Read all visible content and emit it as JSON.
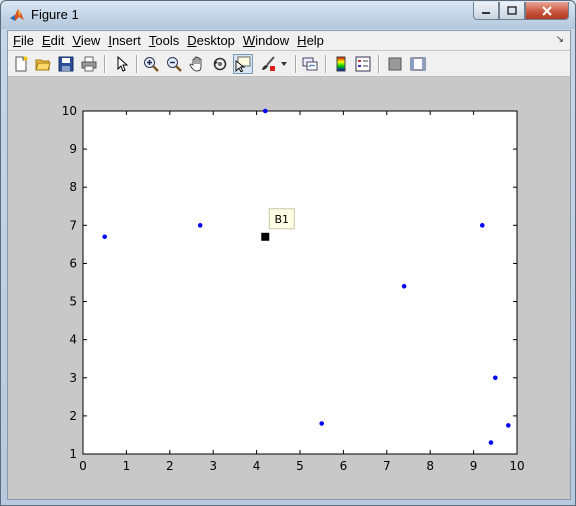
{
  "window": {
    "title": "Figure 1"
  },
  "menu": [
    {
      "label": "File",
      "key": "F",
      "rest": "ile"
    },
    {
      "label": "Edit",
      "key": "E",
      "rest": "dit"
    },
    {
      "label": "View",
      "key": "V",
      "rest": "iew"
    },
    {
      "label": "Insert",
      "key": "I",
      "rest": "nsert"
    },
    {
      "label": "Tools",
      "key": "T",
      "rest": "ools"
    },
    {
      "label": "Desktop",
      "key": "D",
      "rest": "esktop"
    },
    {
      "label": "Window",
      "key": "W",
      "rest": "indow"
    },
    {
      "label": "Help",
      "key": "H",
      "rest": "elp"
    }
  ],
  "toolbar": [
    "new-figure-icon",
    "open-file-icon",
    "save-icon",
    "print-icon",
    "edit-plot-icon",
    "zoom-in-icon",
    "zoom-out-icon",
    "pan-icon",
    "rotate-3d-icon",
    "data-cursor-icon",
    "brush-icon",
    "link-plot-icon",
    "colorbar-icon",
    "legend-icon",
    "hide-plot-tools-icon",
    "show-plot-tools-icon"
  ],
  "chart_data": {
    "type": "scatter",
    "xlim": [
      0,
      10
    ],
    "ylim": [
      1,
      10
    ],
    "xticks": [
      0,
      1,
      2,
      3,
      4,
      5,
      6,
      7,
      8,
      9,
      10
    ],
    "yticks": [
      1,
      2,
      3,
      4,
      5,
      6,
      7,
      8,
      9,
      10
    ],
    "marker_color": "#0000ff",
    "points": [
      {
        "x": 0.5,
        "y": 6.7
      },
      {
        "x": 2.7,
        "y": 7.0
      },
      {
        "x": 4.2,
        "y": 10.0
      },
      {
        "x": 5.5,
        "y": 1.8
      },
      {
        "x": 7.4,
        "y": 5.4
      },
      {
        "x": 9.2,
        "y": 7.0
      },
      {
        "x": 9.4,
        "y": 1.3
      },
      {
        "x": 9.5,
        "y": 3.0
      },
      {
        "x": 9.8,
        "y": 1.75
      }
    ],
    "annotation": {
      "label": "B1",
      "x": 4.2,
      "y": 6.7
    },
    "grid": false
  }
}
